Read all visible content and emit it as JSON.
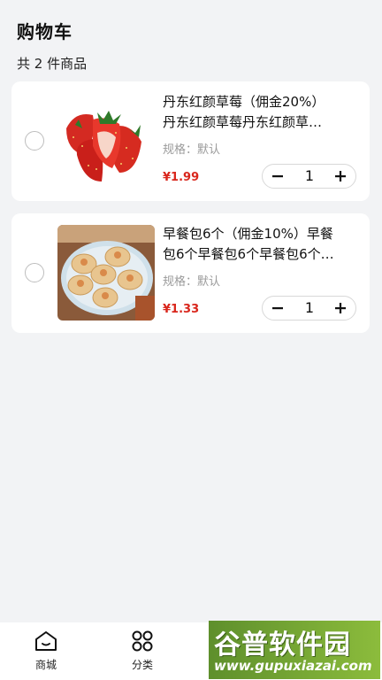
{
  "header": {
    "title": "购物车",
    "count_text": "共 2 件商品"
  },
  "cart": {
    "items": [
      {
        "title_line1": "丹东红颜草莓（佣金20%）",
        "title_line2": "丹东红颜草莓丹东红颜草…",
        "spec": "规格：默认",
        "price": "¥1.99",
        "quantity": "1",
        "image_icon": "strawberry-image",
        "selected": false
      },
      {
        "title_line1": "早餐包6个（佣金10%）早餐",
        "title_line2": "包6个早餐包6个早餐包6个…",
        "spec": "规格：默认",
        "price": "¥1.33",
        "quantity": "1",
        "image_icon": "buns-image",
        "selected": false
      }
    ]
  },
  "tabbar": {
    "tabs": [
      {
        "label": "商城",
        "icon": "home-icon"
      },
      {
        "label": "分类",
        "icon": "category-icon"
      }
    ]
  },
  "watermark": {
    "top": "谷普软件园",
    "bottom": "www.gupuxiazai.com"
  },
  "colors": {
    "price": "#d9261c",
    "background": "#f2f3f5",
    "watermark": "#6fa231"
  }
}
